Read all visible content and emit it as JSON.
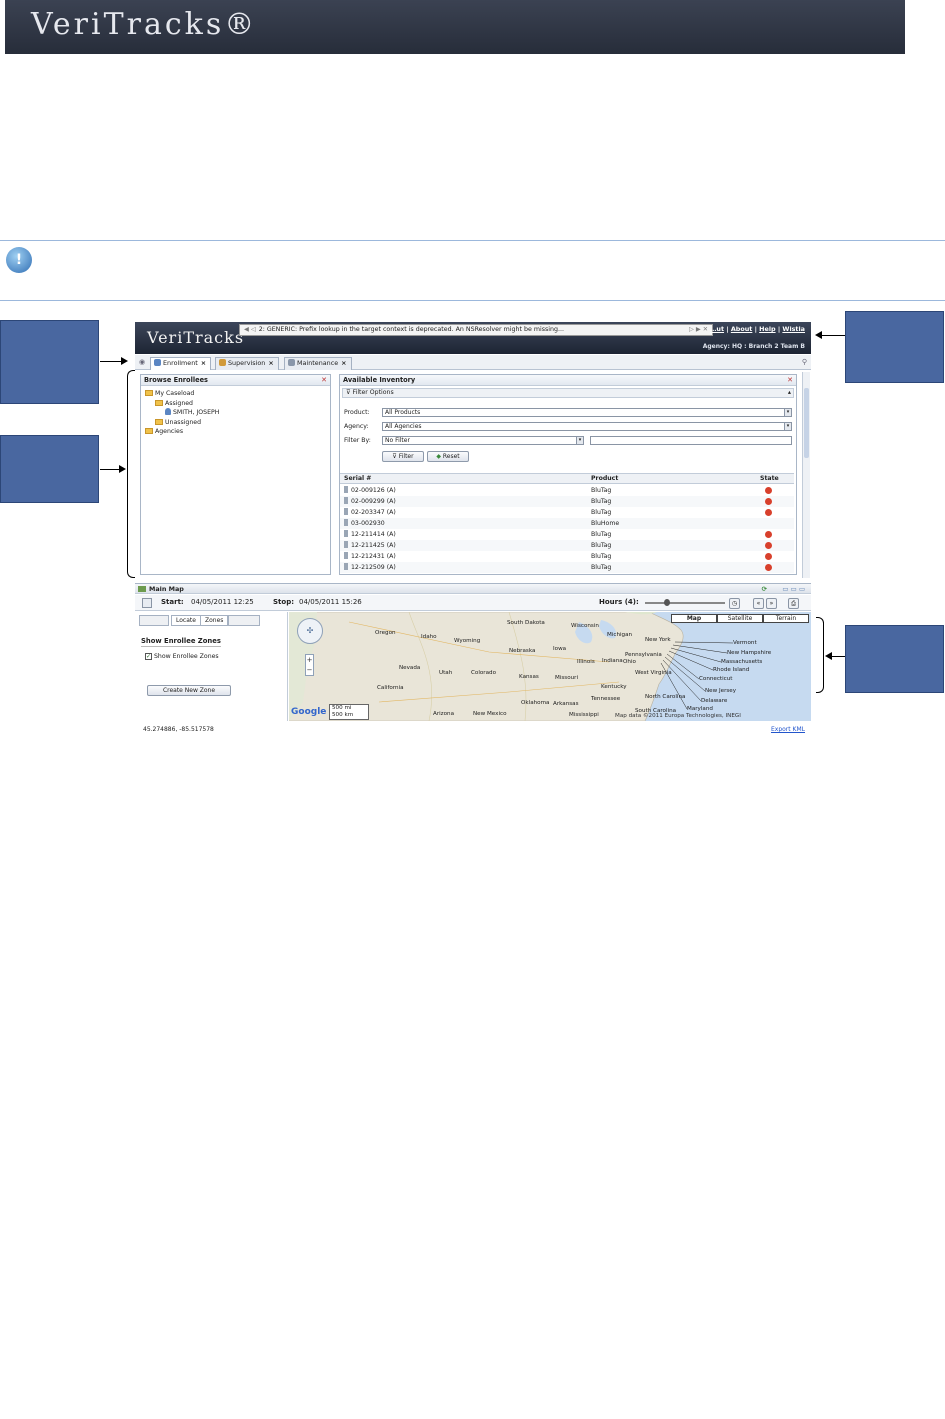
{
  "doc": {
    "brand": "VeriTracks®",
    "note_icon_glyph": "!"
  },
  "app": {
    "logo": "VeriTracks",
    "error_message": "2: GENERIC: Prefix lookup in the target context is deprecated. An NSResolver might be missing...",
    "header_links": [
      "…ut",
      "About",
      "Help",
      "Wistia"
    ],
    "agency_line": "Agency: HQ : Branch 2 Team B",
    "tabs": [
      {
        "label": "Enrollment",
        "icon": "person-icon",
        "active": true
      },
      {
        "label": "Supervision",
        "icon": "supervision-icon",
        "active": false
      },
      {
        "label": "Maintenance",
        "icon": "wrench-icon",
        "active": false
      }
    ],
    "browse": {
      "title": "Browse Enrollees",
      "tree": {
        "my_caseload": "My Caseload",
        "assigned": "Assigned",
        "person": "SMITH, JOSEPH",
        "unassigned": "Unassigned",
        "agencies": "Agencies"
      }
    },
    "inventory": {
      "title": "Available Inventory",
      "filter_options": "Filter Options",
      "product_label": "Product:",
      "product_value": "All Products",
      "agency_label": "Agency:",
      "agency_value": "All Agencies",
      "filter_by_label": "Filter By:",
      "filter_by_value": "No Filter",
      "filter_button": "Filter",
      "reset_button": "Reset",
      "columns": {
        "serial": "Serial #",
        "product": "Product",
        "state": "State"
      },
      "rows": [
        {
          "serial": "02-009126 (A)",
          "product": "BluTag",
          "alert": true
        },
        {
          "serial": "02-009299 (A)",
          "product": "BluTag",
          "alert": true
        },
        {
          "serial": "02-203347 (A)",
          "product": "BluTag",
          "alert": true
        },
        {
          "serial": "03-002930",
          "product": "BluHome",
          "alert": false
        },
        {
          "serial": "12-211414 (A)",
          "product": "BluTag",
          "alert": true
        },
        {
          "serial": "12-211425 (A)",
          "product": "BluTag",
          "alert": true
        },
        {
          "serial": "12-212431 (A)",
          "product": "BluTag",
          "alert": true
        },
        {
          "serial": "12-212509 (A)",
          "product": "BluTag",
          "alert": true
        }
      ]
    },
    "map": {
      "title": "Main Map",
      "start_label": "Start:",
      "start_value": "04/05/2011 12:25",
      "stop_label": "Stop:",
      "stop_value": "04/05/2011 15:26",
      "hours_label": "Hours (4):",
      "side_tabs": [
        "Locate",
        "Zones"
      ],
      "show_zones_heading": "Show Enrollee Zones",
      "show_zones_checkbox": "Show Enrollee Zones",
      "create_zone_button": "Create New Zone",
      "map_types": [
        "Map",
        "Satellite",
        "Terrain"
      ],
      "scale_mi": "500 mi",
      "scale_km": "500 km",
      "google": "Google",
      "copyright": "Map data ©2011 Europa Technologies, INEGI",
      "coords": "45.274886, -85.517578",
      "export": "Export KML",
      "state_labels": [
        "Oregon",
        "Idaho",
        "Wyoming",
        "South Dakota",
        "Wisconsin",
        "Michigan",
        "Iowa",
        "Nebraska",
        "Nevada",
        "Utah",
        "Colorado",
        "Kansas",
        "Missouri",
        "Illinois",
        "Indiana",
        "Ohio",
        "Pennsylvania",
        "New York",
        "California",
        "Oklahoma",
        "Arkansas",
        "Kentucky",
        "West Virginia",
        "Tennessee",
        "North Carolina",
        "Arizona",
        "New Mexico",
        "Mississippi",
        "South Carolina"
      ],
      "ne_labels": [
        "Vermont",
        "New Hampshire",
        "Massachusetts",
        "Rhode Island",
        "Connecticut",
        "New Jersey",
        "Delaware",
        "Maryland"
      ]
    }
  },
  "colors": {
    "callout": "#4967a0",
    "alert": "#d8402c",
    "header_dark": "#1d2433"
  }
}
